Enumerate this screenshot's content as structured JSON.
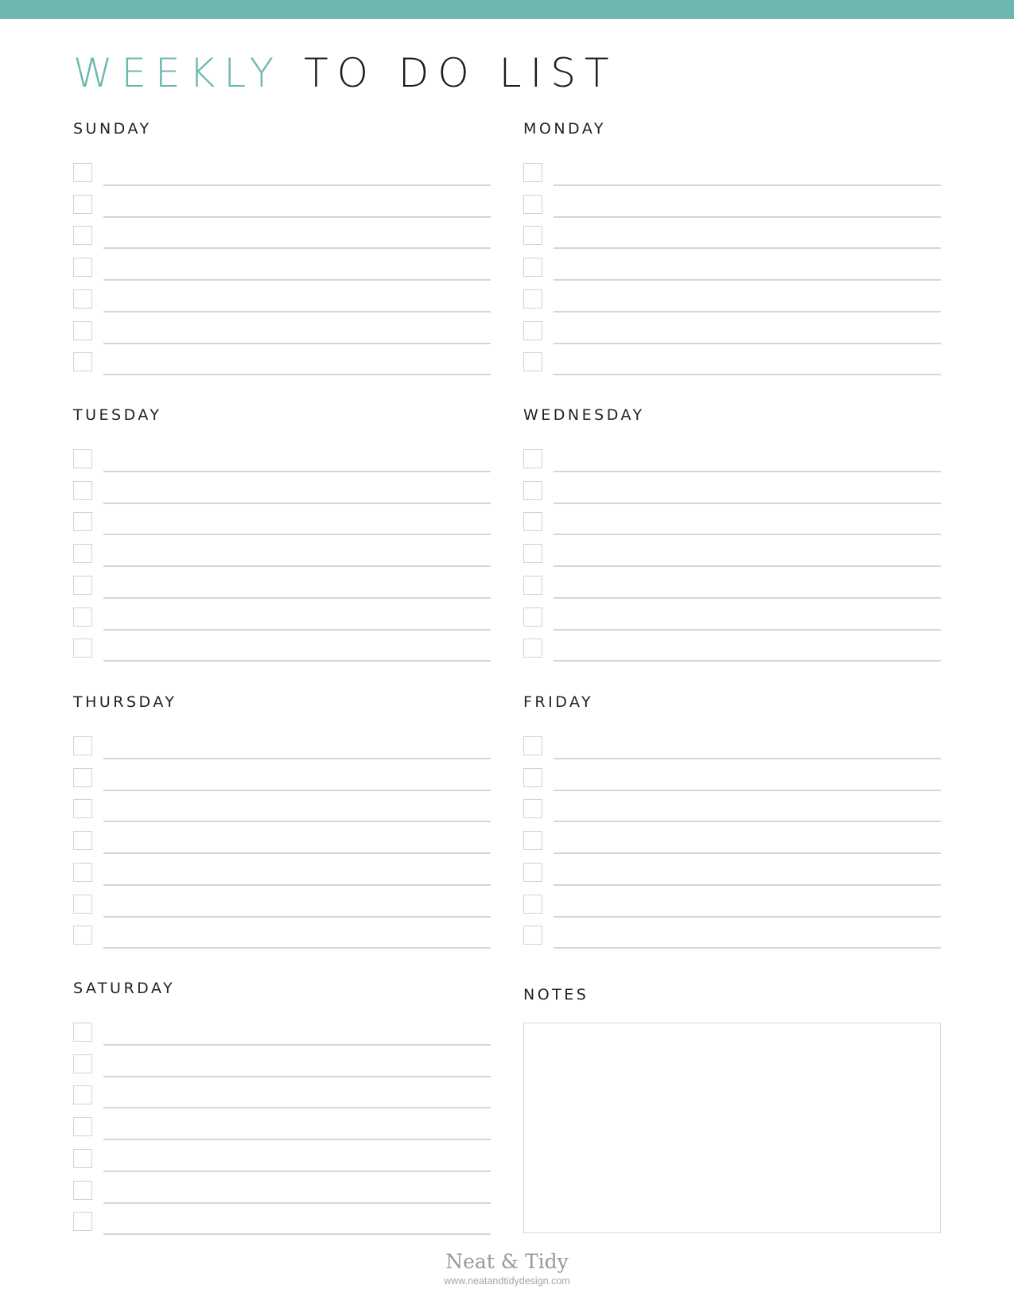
{
  "header": {
    "title_accent": "WEEKLY",
    "title_rest": "TO DO LIST",
    "accent_color": "#6cb8b1"
  },
  "days": [
    {
      "label": "SUNDAY",
      "rows": 7
    },
    {
      "label": "MONDAY",
      "rows": 7
    },
    {
      "label": "TUESDAY",
      "rows": 7
    },
    {
      "label": "WEDNESDAY",
      "rows": 7
    },
    {
      "label": "THURSDAY",
      "rows": 7
    },
    {
      "label": "FRIDAY",
      "rows": 7
    },
    {
      "label": "SATURDAY",
      "rows": 7
    }
  ],
  "notes": {
    "label": "NOTES"
  },
  "footer": {
    "brand": "Neat & Tidy",
    "url": "www.neatandtidydesign.com"
  }
}
